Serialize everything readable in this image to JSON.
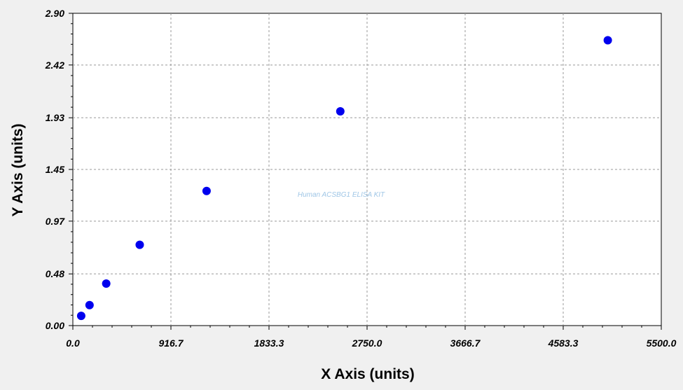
{
  "chart_data": {
    "type": "scatter",
    "title": "",
    "xlabel": "X Axis (units)",
    "ylabel": "Y Axis (units)",
    "annotation": "Human ACSBG1 ELISA KIT",
    "xlim": [
      0,
      5500
    ],
    "ylim": [
      0,
      2.9
    ],
    "x_ticks": [
      "0.0",
      "916.7",
      "1833.3",
      "2750.0",
      "3666.7",
      "4583.3",
      "5500.0"
    ],
    "x_tick_values": [
      0,
      916.7,
      1833.3,
      2750.0,
      3666.7,
      4583.3,
      5500.0
    ],
    "y_ticks": [
      "0.00",
      "0.48",
      "0.97",
      "1.45",
      "1.93",
      "2.42",
      "2.90"
    ],
    "y_tick_values": [
      0,
      0.48,
      0.97,
      1.45,
      1.93,
      2.42,
      2.9
    ],
    "grid": true,
    "series": [
      {
        "points": [
          {
            "x": 78,
            "y": 0.09
          },
          {
            "x": 156,
            "y": 0.19
          },
          {
            "x": 312,
            "y": 0.39
          },
          {
            "x": 625,
            "y": 0.75
          },
          {
            "x": 1250,
            "y": 1.25
          },
          {
            "x": 2500,
            "y": 1.99
          },
          {
            "x": 5000,
            "y": 2.65
          }
        ],
        "color": "#0000ee"
      }
    ],
    "colors": {
      "background": "#f0f0f0",
      "plot_background": "#ffffff",
      "grid": "#999999",
      "marker": "#0000ee"
    }
  }
}
